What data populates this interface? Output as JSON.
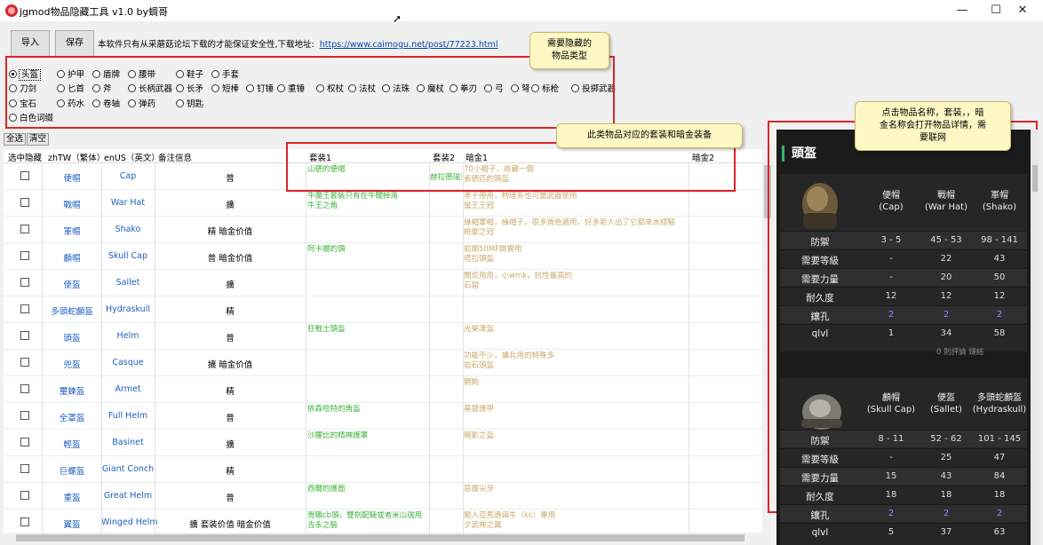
{
  "window": {
    "title": "jgmod物品隐藏工具 v1.0 by蜩哥",
    "min": "—",
    "max": "☐",
    "close": "✕"
  },
  "toolbar": {
    "import_label": "导入",
    "save_label": "保存",
    "notice": "本软件只有从采蘑菇论坛下载的才能保证安全性,下载地址:",
    "link": "https://www.caimogu.net/post/77223.html"
  },
  "categories": {
    "row1": [
      "头盔",
      "护甲",
      "盾牌",
      "腰带",
      "鞋子",
      "手套"
    ],
    "row2": [
      "刀剑",
      "匕首",
      "斧",
      "长柄武器",
      "长矛",
      "短棒",
      "钉锤",
      "重锤",
      "权杖",
      "法杖",
      "法珠",
      "魔杖",
      "拳刃",
      "弓",
      "弩",
      "标枪",
      "投掷武器"
    ],
    "row3": [
      "宝石",
      "药水",
      "卷轴",
      "弹药",
      "钥匙"
    ],
    "row4": [
      "白色词缀"
    ],
    "selected": "头盔"
  },
  "buttons": {
    "select_all": "全选",
    "clear": "清空"
  },
  "table": {
    "headers": [
      "选中隐藏",
      "zhTW（繁体）",
      "enUS（英文）",
      "备注信息",
      "套装1",
      "套装2",
      "暗金1",
      "暗金2"
    ],
    "rows": [
      {
        "zh": "便帽",
        "en": "Cap",
        "note": "普",
        "set1": "山德的便帽",
        "set2": "赫拉德瑞克",
        "gold1": "70小帽子、收藏一個\n索德匹的頭盔"
      },
      {
        "zh": "戰帽",
        "en": "War Hat",
        "note": "擴",
        "set1": "牛魔王套裝只有在牛關掉落\n牛王之角",
        "set2": "",
        "gold1": "孝子帶用，物理系也可當武器使用\n蠻王王冠"
      },
      {
        "zh": "軍帽",
        "en": "Shako",
        "note": "精 暗金价值",
        "set1": "",
        "set2": "",
        "gold1": "綠帽軍帽，綠帽子，很多角色適用，好多新人出了它都來水經驗\n統御之冠"
      },
      {
        "zh": "顱帽",
        "en": "Skull Cap",
        "note": "普 暗金价值",
        "set1": "阿卡娜的頭",
        "set2": "",
        "gold1": "前期50MF跳實用\n塔拉頭盔"
      },
      {
        "zh": "便盔",
        "en": "Sallet",
        "note": "擴",
        "set1": "",
        "set2": "",
        "gold1": "開荒用用，小wmk，抗性最高的\n石窟"
      },
      {
        "zh": "多頭蛇顱盔",
        "en": "Hydraskull",
        "note": "精",
        "set1": "",
        "set2": "",
        "gold1": ""
      },
      {
        "zh": "頭盔",
        "en": "Helm",
        "note": "普",
        "set1": "狂戰士頭盔",
        "set2": "",
        "gold1": "光榮凜盔"
      },
      {
        "zh": "兜盔",
        "en": "Casque",
        "note": "擴 暗金价值",
        "set1": "",
        "set2": "",
        "gold1": "功能不少，傭兵用的特殊多\n岩石頭盔"
      },
      {
        "zh": "璽鍊盔",
        "en": "Armet",
        "note": "精",
        "set1": "",
        "set2": "",
        "gold1": "鋼鉤"
      },
      {
        "zh": "全罩盔",
        "en": "Full Helm",
        "note": "普",
        "set1": "依森哈特的角盔",
        "set2": "",
        "gold1": "基督護甲"
      },
      {
        "zh": "輕盔",
        "en": "Basinet",
        "note": "擴",
        "set1": "沙羅比的精神護罩",
        "set2": "",
        "gold1": "暗影之盔"
      },
      {
        "zh": "巨螺盔",
        "en": "Giant Conch",
        "note": "精",
        "set1": "",
        "set2": "",
        "gold1": ""
      },
      {
        "zh": "重盔",
        "en": "Great Helm",
        "note": "普",
        "set1": "西爾的護面",
        "set2": "",
        "gold1": "惡魔尖牙"
      },
      {
        "zh": "翼盔",
        "en": "Winged Helm",
        "note": "擴 套装价值 暗金价值",
        "set1": "骨職cb頭，雙劍配騎或者米山瑞用\n吉永之臉",
        "set2": "",
        "gold1": "闖入亞馬遜與牛（kc）專用\n夕武神之翼"
      }
    ]
  },
  "tips": {
    "hide_type": "需要隐藏的\n物品类型",
    "set_gold": "此类物品对应的套装和暗金装备",
    "detail": "点击物品名称，套装，，暗\n金名称会打开物品详情，需\n要联网"
  },
  "panel": {
    "title": "頭盔",
    "card1": {
      "cols": [
        "便帽\n(Cap)",
        "戰帽\n(War Hat)",
        "軍帽\n(Shako)"
      ],
      "stats": [
        {
          "k": "防禦",
          "v": [
            "3 - 5",
            "45 - 53",
            "98 - 141"
          ]
        },
        {
          "k": "需要等級",
          "v": [
            "-",
            "22",
            "43"
          ]
        },
        {
          "k": "需要力量",
          "v": [
            "-",
            "20",
            "50"
          ]
        },
        {
          "k": "耐久度",
          "v": [
            "12",
            "12",
            "12"
          ]
        },
        {
          "k": "鑲孔",
          "v": [
            "2",
            "2",
            "2"
          ]
        },
        {
          "k": "qlvl",
          "v": [
            "1",
            "34",
            "58"
          ]
        }
      ],
      "footer": "0 則評論   鏈結"
    },
    "card2": {
      "cols": [
        "顱帽\n(Skull Cap)",
        "便盔\n(Sallet)",
        "多頭蛇顱盔\n(Hydraskull)"
      ],
      "stats": [
        {
          "k": "防禦",
          "v": [
            "8 - 11",
            "52 - 62",
            "101 - 145"
          ]
        },
        {
          "k": "需要等級",
          "v": [
            "-",
            "25",
            "47"
          ]
        },
        {
          "k": "需要力量",
          "v": [
            "15",
            "43",
            "84"
          ]
        },
        {
          "k": "耐久度",
          "v": [
            "18",
            "18",
            "18"
          ]
        },
        {
          "k": "鑲孔",
          "v": [
            "2",
            "2",
            "2"
          ]
        },
        {
          "k": "qlvl",
          "v": [
            "5",
            "37",
            "63"
          ]
        }
      ]
    }
  }
}
